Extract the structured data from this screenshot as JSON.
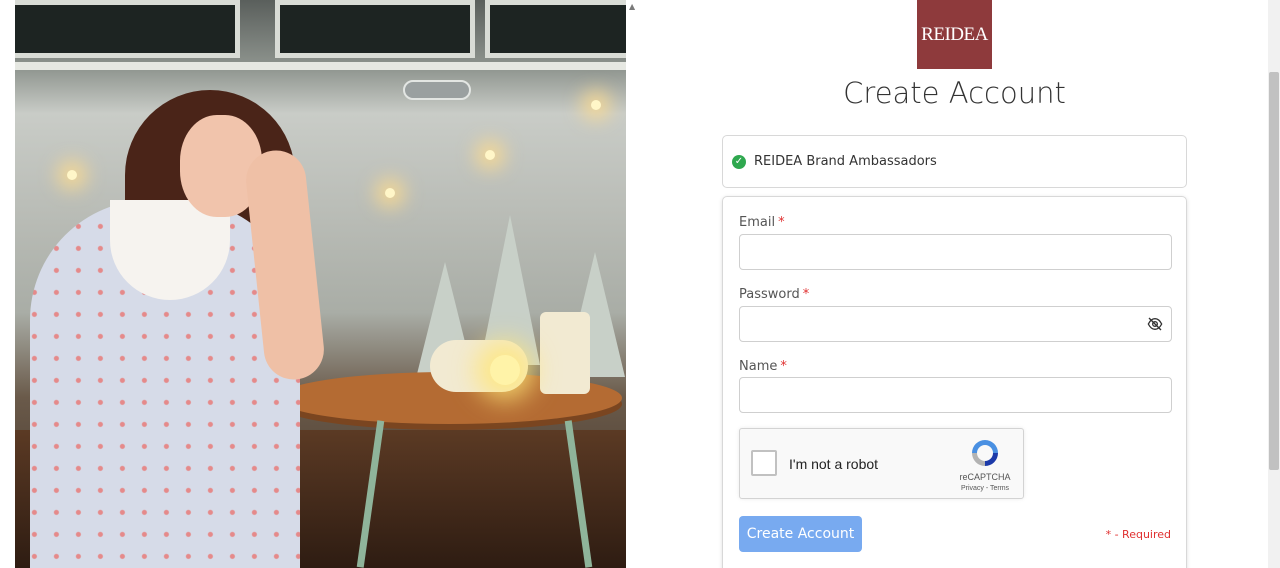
{
  "brand": {
    "logo_text": "REIDEA",
    "logo_color": "#8e3a3c"
  },
  "page": {
    "title": "Create Account"
  },
  "program": {
    "name": "REIDEA Brand Ambassadors",
    "selected": true
  },
  "form": {
    "email": {
      "label": "Email",
      "required_mark": "*",
      "value": ""
    },
    "password": {
      "label": "Password",
      "required_mark": "*",
      "value": "",
      "toggle_icon": "eye-off-icon"
    },
    "name": {
      "label": "Name",
      "required_mark": "*",
      "value": ""
    },
    "recaptcha": {
      "label": "I'm not a robot",
      "brand": "reCAPTCHA",
      "links": "Privacy - Terms",
      "checked": false
    },
    "submit_label": "Create Account",
    "required_note": "* - Required"
  },
  "colors": {
    "accent": "#78aaf0",
    "required": "#e03030",
    "check": "#2fa84f"
  }
}
